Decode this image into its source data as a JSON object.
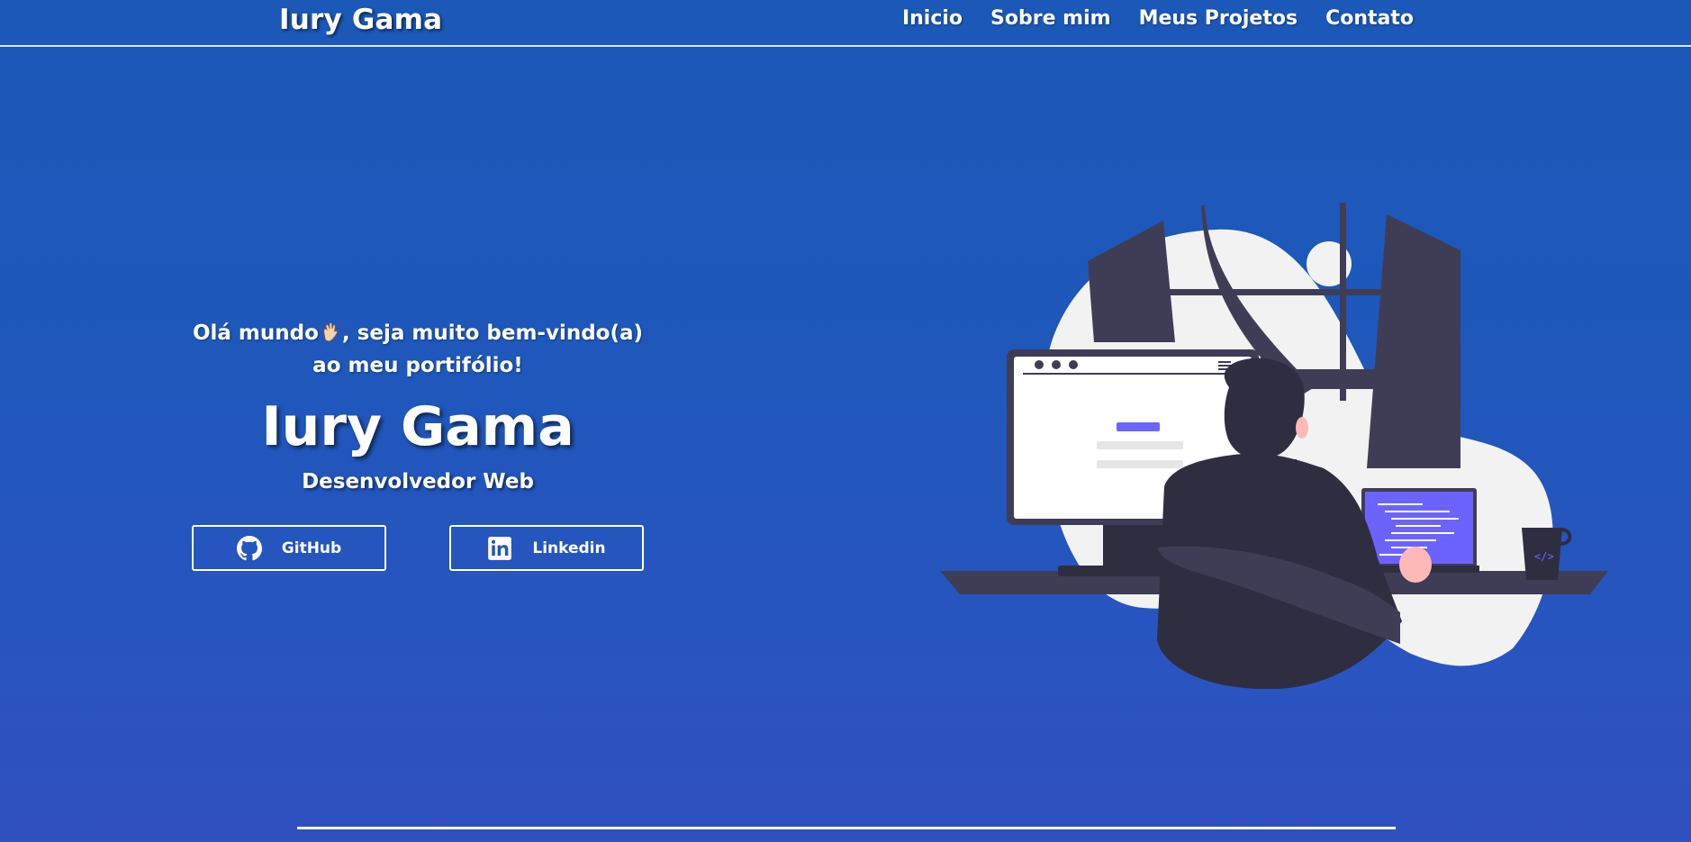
{
  "nav": {
    "brand": "Iury Gama",
    "links": [
      "Inicio",
      "Sobre mim",
      "Meus Projetos",
      "Contato"
    ]
  },
  "hero": {
    "greeting_line1_before": "Olá mundo",
    "greeting_emoji": "waving-hand",
    "greeting_line1_after": ", seja muito bem-vindo(a)",
    "greeting_line2": "ao meu portifólio!",
    "name": "Iury Gama",
    "role": "Desenvolvedor Web"
  },
  "buttons": {
    "github": {
      "label": "GitHub",
      "icon": "github-icon"
    },
    "linkedin": {
      "label": "Linkedin",
      "icon": "linkedin-icon"
    }
  },
  "illustration": {
    "icon": "developer-at-desk-illustration"
  },
  "colors": {
    "background_top": "#1c58b8",
    "background_bottom": "#3050bf",
    "accent_purple": "#6c63ff",
    "dark": "#3f3d56",
    "light_gray": "#f2f2f2"
  }
}
